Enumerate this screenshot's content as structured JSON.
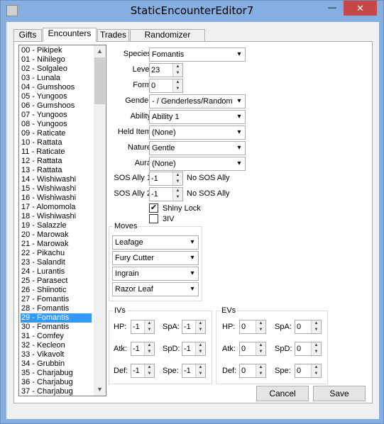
{
  "window": {
    "title": "StaticEncounterEditor7",
    "minimize_glyph": "—",
    "close_glyph": "✕"
  },
  "tabs": [
    {
      "label": "Gifts"
    },
    {
      "label": "Encounters"
    },
    {
      "label": "Trades"
    },
    {
      "label": "Randomizer Options"
    }
  ],
  "encounter_list": {
    "selected_index": 29,
    "items": [
      "00 - Pikipek",
      "01 - Nihilego",
      "02 - Solgaleo",
      "03 - Lunala",
      "04 - Gumshoos",
      "05 - Yungoos",
      "06 - Gumshoos",
      "07 - Yungoos",
      "08 - Yungoos",
      "09 - Raticate",
      "10 - Rattata",
      "11 - Raticate",
      "12 - Rattata",
      "13 - Rattata",
      "14 - Wishiwashi",
      "15 - Wishiwashi",
      "16 - Wishiwashi",
      "17 - Alomomola",
      "18 - Wishiwashi",
      "19 - Salazzle",
      "20 - Marowak",
      "21 - Marowak",
      "22 - Pikachu",
      "23 - Salandit",
      "24 - Lurantis",
      "25 - Parasect",
      "26 - Shiinotic",
      "27 - Fomantis",
      "28 - Fomantis",
      "29 - Fomantis",
      "30 - Fomantis",
      "31 - Comfey",
      "32 - Kecleon",
      "33 - Vikavolt",
      "34 - Grubbin",
      "35 - Charjabug",
      "36 - Charjabug",
      "37 - Charjabug"
    ]
  },
  "form": {
    "species": {
      "label": "Species:",
      "value": "Fomantis"
    },
    "level": {
      "label": "Level:",
      "value": "23"
    },
    "form": {
      "label": "Form:",
      "value": "0"
    },
    "gender": {
      "label": "Gender:",
      "value": "- / Genderless/Random"
    },
    "ability": {
      "label": "Ability:",
      "value": "Ability 1"
    },
    "held_item": {
      "label": "Held Item:",
      "value": "(None)"
    },
    "nature": {
      "label": "Nature:",
      "value": "Gentle"
    },
    "aura": {
      "label": "Aura:",
      "value": "(None)"
    },
    "sos1": {
      "label": "SOS Ally 1:",
      "value": "-1",
      "status": "No SOS Ally"
    },
    "sos2": {
      "label": "SOS Ally 2:",
      "value": "-1",
      "status": "No SOS Ally"
    },
    "shiny_lock": {
      "label": "Shiny Lock",
      "checked": true
    },
    "three_iv": {
      "label": "3IV",
      "checked": false
    }
  },
  "moves": {
    "title": "Moves",
    "items": [
      "Leafage",
      "Fury Cutter",
      "Ingrain",
      "Razor Leaf"
    ]
  },
  "ivs": {
    "title": "IVs",
    "hp": {
      "label": "HP:",
      "value": "-1"
    },
    "atk": {
      "label": "Atk:",
      "value": "-1"
    },
    "def": {
      "label": "Def:",
      "value": "-1"
    },
    "spa": {
      "label": "SpA:",
      "value": "-1"
    },
    "spd": {
      "label": "SpD:",
      "value": "-1"
    },
    "spe": {
      "label": "Spe:",
      "value": "-1"
    }
  },
  "evs": {
    "title": "EVs",
    "hp": {
      "label": "HP:",
      "value": "0"
    },
    "atk": {
      "label": "Atk:",
      "value": "0"
    },
    "def": {
      "label": "Def:",
      "value": "0"
    },
    "spa": {
      "label": "SpA:",
      "value": "0"
    },
    "spd": {
      "label": "SpD:",
      "value": "0"
    },
    "spe": {
      "label": "Spe:",
      "value": "0"
    }
  },
  "buttons": {
    "cancel": "Cancel",
    "save": "Save"
  },
  "colors": {
    "titlebar": "#87aee0",
    "selection": "#3399ff",
    "close": "#c74646"
  }
}
